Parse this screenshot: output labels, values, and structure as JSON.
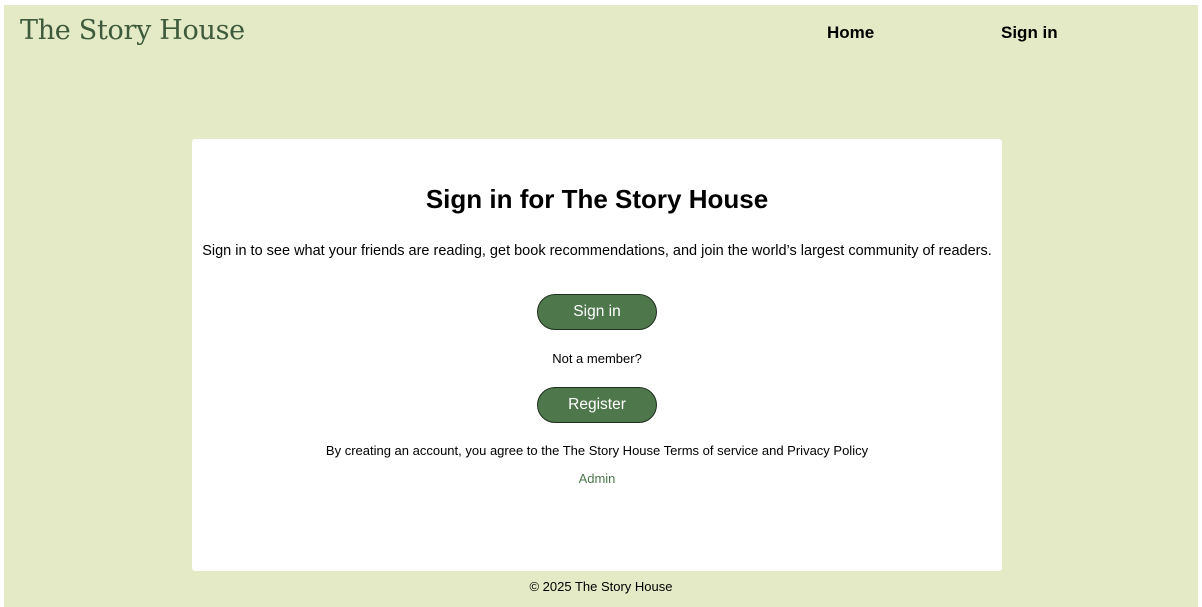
{
  "header": {
    "logo": "The Story House",
    "nav": {
      "home": "Home",
      "sign_in": "Sign in"
    }
  },
  "card": {
    "title": "Sign in for The Story House",
    "subtitle": "Sign in to see what your friends are reading, get book recommendations, and join the world’s largest community of readers.",
    "sign_in_button": "Sign in",
    "not_member": "Not a member?",
    "register_button": "Register",
    "terms": "By creating an account, you agree to the The Story House Terms of service and Privacy Policy",
    "admin_link": "Admin"
  },
  "footer": {
    "copyright": "© 2025 The Story House"
  },
  "colors": {
    "page_background": "#e4eac6",
    "brand_green": "#4e774c",
    "logo_green": "#3d5a3c",
    "card_background": "#ffffff"
  }
}
